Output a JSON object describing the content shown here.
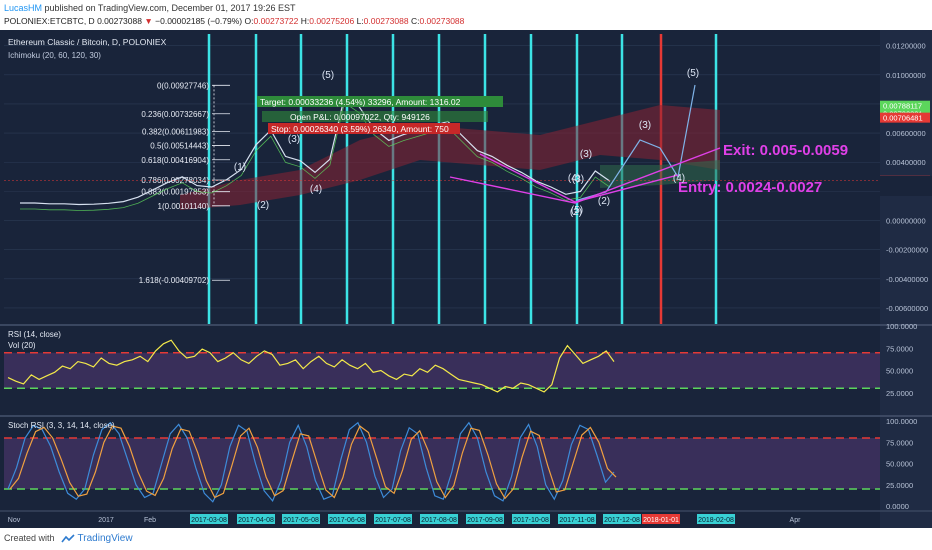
{
  "header": {
    "user": "LucasHM",
    "published": "published on TradingView.com, December 01, 2017 19:26 EST",
    "symbol": "POLONIEX:ETCBTC, D",
    "last": "0.00273088",
    "change": "−0.00002185 (−0.79%)",
    "o_label": "O:",
    "o": "0.00273722",
    "h_label": "H:",
    "h": "0.00275206",
    "l_label": "L:",
    "l": "0.00273088",
    "c_label": "C:",
    "c": "0.00273088"
  },
  "footer": {
    "created_with": "Created with",
    "brand": "TradingView"
  },
  "colors": {
    "bg": "#19243a",
    "grid": "#2c3a55",
    "axis_text": "#b7c2d6",
    "cyan": "#3ce3e5",
    "red": "#e53935",
    "magenta": "#e040e8",
    "yellow": "#f3e94a",
    "green": "#5cd65c",
    "blue": "#3d8bd9",
    "orange": "#f0a040"
  },
  "chart_data": [
    {
      "type": "line",
      "title": "Ethereum Classic / Bitcoin, D, POLONIEX",
      "subtitle": "Ichimoku (20, 60, 120, 30)",
      "ylim": [
        -0.0071,
        0.0128
      ],
      "y_ticks": [
        "0.01200000",
        "0.01000000",
        "0.00800000",
        "0.00600000",
        "0.00400000",
        "0.00200000",
        "0.00000000",
        "-0.00200000",
        "-0.00400000",
        "-0.00600000"
      ],
      "x_labels": [
        "Nov",
        "2017",
        "Feb",
        "2017-03-08",
        "2017-04-08",
        "2017-05-08",
        "2017-06-08",
        "2017-07-08",
        "2017-08-08",
        "2017-09-08",
        "2017-10-08",
        "2017-11-08",
        "2017-12-08",
        "2018-01-01",
        "2018-02-08",
        "Apr"
      ],
      "price_labels": [
        {
          "text": "0.00788117",
          "value": 0.00788,
          "color": "green"
        },
        {
          "text": "0.00732821",
          "value": 0.00733,
          "color": "green"
        },
        {
          "text": "0.00706481",
          "value": 0.00706,
          "color": "red"
        },
        {
          "text": "0.00273088",
          "value": 0.00273,
          "color": "red"
        }
      ],
      "fib_levels": [
        {
          "text": "0(0.00927746)",
          "value": 0.00927746
        },
        {
          "text": "0.236(0.00732667)",
          "value": 0.00732667
        },
        {
          "text": "0.382(0.00611983)",
          "value": 0.00611983
        },
        {
          "text": "0.5(0.00514443)",
          "value": 0.00514443
        },
        {
          "text": "0.618(0.00416904)",
          "value": 0.00416904
        },
        {
          "text": "0.786(0.00278034)",
          "value": 0.00278034
        },
        {
          "text": "0.883(0.00197853)",
          "value": 0.00197853
        },
        {
          "text": "1(0.00101140)",
          "value": 0.0010114
        },
        {
          "text": "1.618(-0.00409702)",
          "value": -0.00409702
        }
      ],
      "position_labels": {
        "target": "Target: 0.00033236 (4.54%) 33296, Amount: 1316.02",
        "open": "Open P&L: 0.00097022, Qty: 949126",
        "stop": "Stop: 0.00026340 (3.59%) 26340, Amount: 750"
      },
      "annotations": {
        "exit": "Exit: 0.005-0.0059",
        "entry": "Entry: 0.0024-0.0027"
      },
      "wave_labels": [
        "(1)",
        "(2)",
        "(3)",
        "(4)",
        "(5)",
        "(3)",
        "(4)",
        "(5)",
        "(2)",
        "(3)",
        "(4)",
        "(3)",
        "(5)",
        "(2)"
      ],
      "price": {
        "x": [
          0,
          5,
          10,
          15,
          20,
          25,
          30,
          35,
          40,
          45,
          50,
          55,
          60,
          65,
          70,
          75,
          80,
          85,
          90,
          95,
          100,
          105,
          110,
          115,
          120,
          125,
          130,
          135,
          140,
          145,
          150,
          155,
          160,
          165,
          170,
          175,
          180,
          185,
          190,
          195,
          200
        ],
        "y": [
          0.0012,
          0.0012,
          0.00115,
          0.00115,
          0.0011,
          0.00112,
          0.00118,
          0.0013,
          0.0016,
          0.0021,
          0.0026,
          0.003,
          0.0024,
          0.0023,
          0.0028,
          0.0035,
          0.0052,
          0.0062,
          0.0044,
          0.0041,
          0.0033,
          0.0042,
          0.0085,
          0.0078,
          0.0063,
          0.0055,
          0.0059,
          0.0062,
          0.0065,
          0.0068,
          0.0058,
          0.0048,
          0.0044,
          0.0038,
          0.0033,
          0.0027,
          0.0023,
          0.0018,
          0.002,
          0.0034,
          0.0027
        ]
      }
    },
    {
      "type": "line",
      "title": "RSI (14, close)",
      "subtitle": "Vol (20)",
      "ylim": [
        0,
        100
      ],
      "y_ticks": [
        "100.0000",
        "75.0000",
        "50.0000",
        "25.0000"
      ],
      "levels": [
        70,
        30
      ],
      "values": [
        42,
        38,
        35,
        45,
        40,
        44,
        48,
        55,
        52,
        60,
        58,
        54,
        64,
        58,
        56,
        60,
        62,
        66,
        60,
        72,
        80,
        84,
        72,
        64,
        66,
        74,
        70,
        60,
        64,
        70,
        62,
        58,
        66,
        72,
        68,
        56,
        58,
        62,
        52,
        60,
        66,
        58,
        54,
        62,
        56,
        52,
        58,
        48,
        50,
        44,
        40,
        46,
        44,
        52,
        48,
        56,
        52,
        46,
        40,
        38,
        36,
        34,
        30,
        26,
        32,
        30,
        36,
        34,
        30,
        26,
        34,
        64,
        78,
        68,
        58,
        62,
        66,
        72,
        60
      ]
    },
    {
      "type": "line",
      "title": "Stoch RSI (3, 3, 14, 14, close)",
      "ylim": [
        0,
        100
      ],
      "y_ticks": [
        "100.0000",
        "75.0000",
        "50.0000",
        "25.0000",
        "0.0000"
      ],
      "levels": [
        80,
        20
      ],
      "k": [
        20,
        45,
        80,
        95,
        90,
        70,
        40,
        15,
        8,
        20,
        60,
        90,
        98,
        85,
        55,
        25,
        10,
        15,
        50,
        85,
        96,
        80,
        45,
        15,
        5,
        25,
        70,
        95,
        88,
        50,
        18,
        6,
        30,
        75,
        95,
        70,
        30,
        8,
        12,
        55,
        90,
        98,
        75,
        35,
        10,
        20,
        65,
        92,
        85,
        45,
        12,
        8,
        40,
        85,
        98,
        80,
        40,
        12,
        6,
        35,
        80,
        96,
        70,
        25,
        8,
        30,
        72,
        95,
        90,
        60,
        28,
        40
      ]
    }
  ]
}
